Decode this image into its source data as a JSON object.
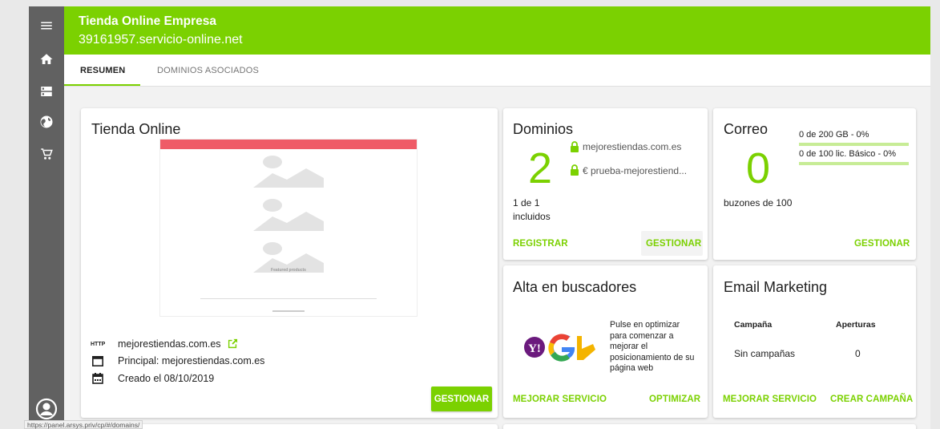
{
  "header": {
    "title": "Tienda Online Empresa",
    "subtitle": "39161957.servicio-online.net"
  },
  "tabs": [
    {
      "label": "RESUMEN"
    },
    {
      "label": "DOMINIOS ASOCIADOS"
    }
  ],
  "sidebar": {
    "icons": [
      "menu-icon",
      "home-icon",
      "server-icon",
      "globe-icon",
      "cart-icon"
    ],
    "bottom_icon": "account-icon"
  },
  "tienda": {
    "title": "Tienda Online",
    "preview_heading": "Featured products",
    "http_tag": "HTTP",
    "domain": "mejorestiendas.com.es",
    "principal": "Principal: mejorestiendas.com.es",
    "created": "Creado el 08/10/2019",
    "button": "GESTIONAR"
  },
  "dominios": {
    "title": "Dominios",
    "count": "2",
    "domains": [
      "mejorestiendas.com.es",
      "€ prueba-mejorestiend..."
    ],
    "included_line1": "1 de 1",
    "included_line2": "incluidos",
    "register": "REGISTRAR",
    "manage": "GESTIONAR"
  },
  "correo": {
    "title": "Correo",
    "count": "0",
    "storage": "0 de 200 GB - 0%",
    "licenses": "0 de 100 lic. Básico - 0%",
    "storage_fill": 0,
    "licenses_fill": 0,
    "mailboxes": "buzones de 100",
    "manage": "GESTIONAR"
  },
  "buscadores": {
    "title": "Alta en buscadores",
    "description": "Pulse en optimizar para comenzar a mejorar el posicionamiento de su página web",
    "desc_lines": [
      "Pulse en optimizar",
      "para comenzar a",
      "mejorar el",
      "posicionamiento de su",
      "página web"
    ],
    "improve": "MEJORAR SERVICIO",
    "optimize": "OPTIMIZAR"
  },
  "email_marketing": {
    "title": "Email Marketing",
    "col_campaign": "Campaña",
    "col_opens": "Aperturas",
    "row_campaign": "Sin campañas",
    "row_opens": "0",
    "improve": "MEJORAR SERVICIO",
    "create": "CREAR CAMPAÑA"
  },
  "status_url": "https://panel.arsys.priv/cp/#/domains/",
  "colors": {
    "brand": "#7bd101",
    "sidebar": "#616161",
    "preview_bar": "#ef5b67"
  }
}
